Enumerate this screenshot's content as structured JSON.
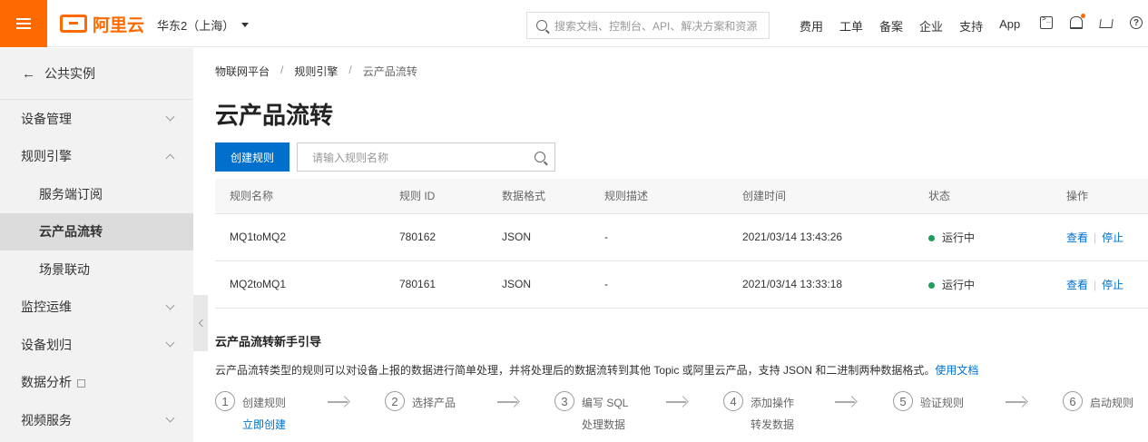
{
  "topbar": {
    "logo_text": "阿里云",
    "region": "华东2（上海）",
    "search_placeholder": "搜索文档、控制台、API、解决方案和资源",
    "nav": [
      "费用",
      "工单",
      "备案",
      "企业",
      "支持",
      "App"
    ],
    "icons": [
      "terminal-icon",
      "bell-icon",
      "cart-icon",
      "help-icon"
    ],
    "help_glyph": "?",
    "accent": "#ff6a00"
  },
  "sidebar": {
    "back_label": "公共实例",
    "items": [
      {
        "label": "设备管理",
        "expandable": true,
        "expanded": false
      },
      {
        "label": "规则引擎",
        "expandable": true,
        "expanded": true
      },
      {
        "label": "服务端订阅",
        "sub": true
      },
      {
        "label": "云产品流转",
        "sub": true,
        "active": true
      },
      {
        "label": "场景联动",
        "sub": true
      },
      {
        "label": "监控运维",
        "expandable": true,
        "expanded": false
      },
      {
        "label": "设备划归",
        "expandable": true,
        "expanded": false
      },
      {
        "label": "数据分析",
        "external": true
      },
      {
        "label": "视频服务",
        "expandable": true,
        "expanded": false
      }
    ]
  },
  "breadcrumb": [
    "物联网平台",
    "规则引擎",
    "云产品流转"
  ],
  "page": {
    "title": "云产品流转",
    "create_button": "创建规则",
    "search_placeholder": "请输入规则名称"
  },
  "table": {
    "columns": [
      "规则名称",
      "规则 ID",
      "数据格式",
      "规则描述",
      "创建时间",
      "状态",
      "操作"
    ],
    "rows": [
      {
        "name": "MQ1toMQ2",
        "id": "780162",
        "format": "JSON",
        "desc": "-",
        "created": "2021/03/14 13:43:26",
        "status": "运行中",
        "view": "查看",
        "stop": "停止"
      },
      {
        "name": "MQ2toMQ1",
        "id": "780161",
        "format": "JSON",
        "desc": "-",
        "created": "2021/03/14 13:33:18",
        "status": "运行中",
        "view": "查看",
        "stop": "停止"
      }
    ],
    "status_color": "#1e9e5a",
    "link_color": "#0070cc"
  },
  "guide": {
    "title": "云产品流转新手引导",
    "description": "云产品流转类型的规则可以对设备上报的数据进行简单处理，并将处理后的数据流转到其他 Topic 或阿里云产品，支持 JSON 和二进制两种数据格式。",
    "doc_link": "使用文档",
    "steps": [
      {
        "num": "1",
        "label": "创建规则",
        "sub": "立即创建",
        "sub_link": true
      },
      {
        "num": "2",
        "label": "选择产品"
      },
      {
        "num": "3",
        "label": "编写 SQL",
        "sub": "处理数据"
      },
      {
        "num": "4",
        "label": "添加操作",
        "sub": "转发数据"
      },
      {
        "num": "5",
        "label": "验证规则"
      },
      {
        "num": "6",
        "label": "启动规则"
      }
    ]
  }
}
